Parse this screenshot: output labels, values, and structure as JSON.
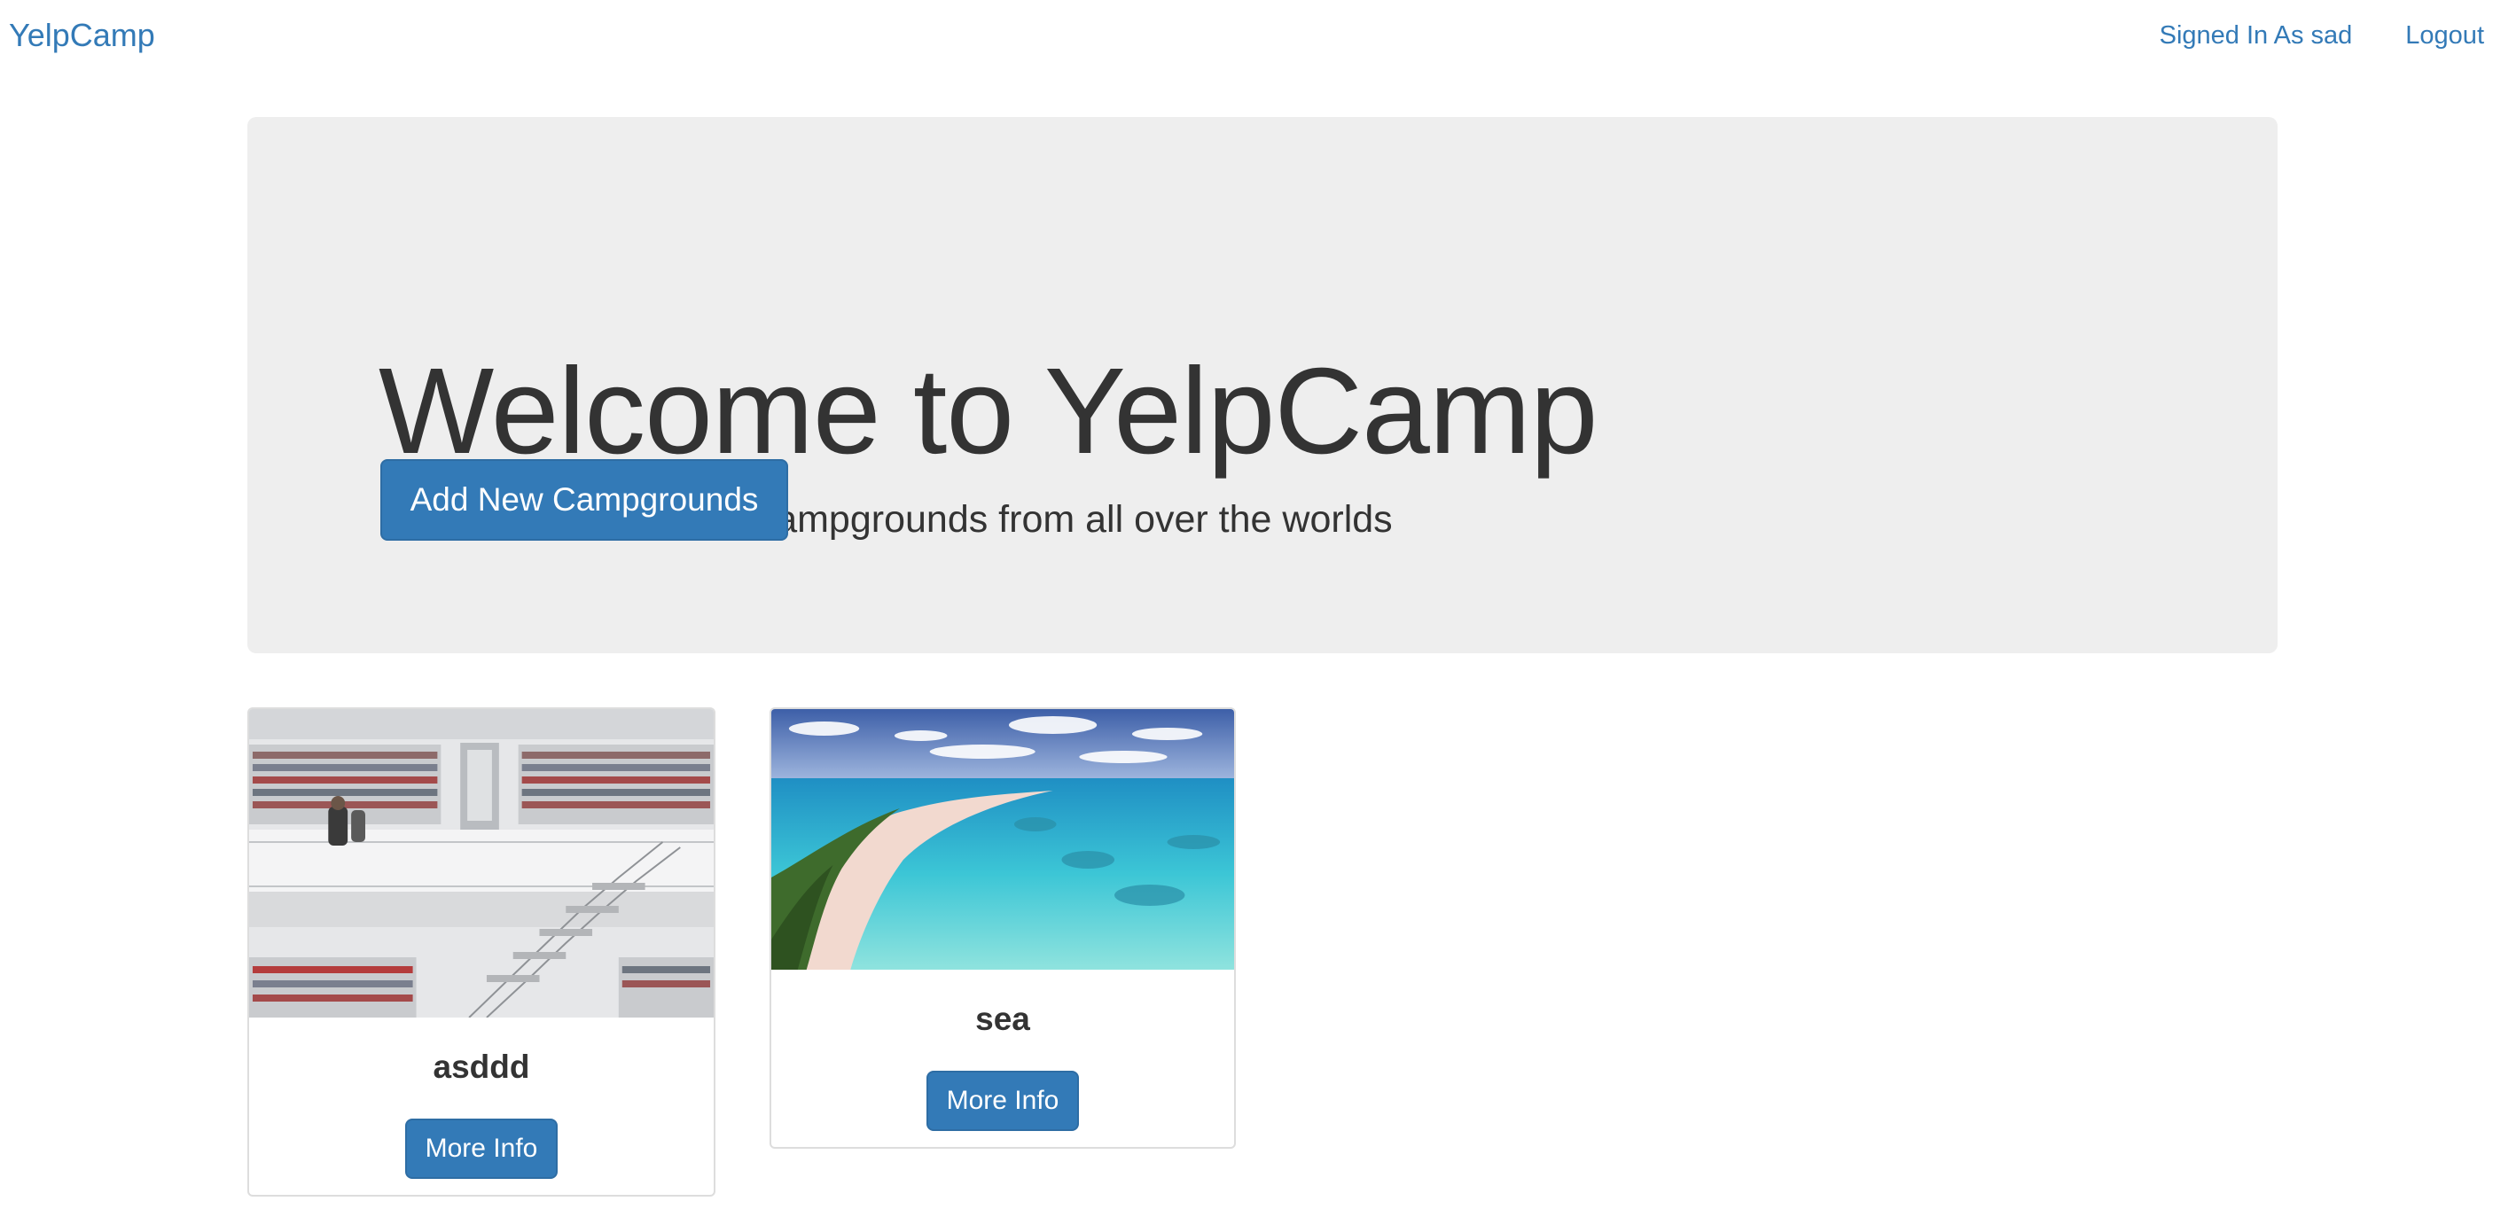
{
  "navbar": {
    "brand": "YelpCamp",
    "user_status": "Signed In As sad",
    "logout": "Logout"
  },
  "jumbotron": {
    "title": "Welcome to YelpCamp",
    "subtitle": "View our hand-picked campgrounds from all over the worlds",
    "add_button": "Add New Campgrounds"
  },
  "campgrounds": [
    {
      "name": "asddd",
      "button": "More Info",
      "image": "library-photo"
    },
    {
      "name": "sea",
      "button": "More Info",
      "image": "tropical-beach-photo"
    }
  ],
  "colors": {
    "link": "#337ab7",
    "primary_button": "#337ab7",
    "jumbotron_bg": "#eeeeee",
    "text": "#333333"
  }
}
